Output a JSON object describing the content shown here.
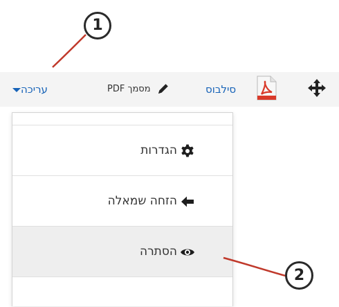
{
  "toolbar": {
    "edit_menu_label": "עריכה",
    "document_label": "מסמך PDF",
    "syllabus_link": "סילבוס"
  },
  "dropdown": {
    "items": [
      {
        "label": "הגדרות",
        "icon": "gear-icon"
      },
      {
        "label": "הזחה שמאלה",
        "icon": "arrow-left-icon"
      },
      {
        "label": "הסתרה",
        "icon": "eye-icon"
      }
    ]
  },
  "callouts": {
    "first": "1",
    "second": "2"
  },
  "colors": {
    "link_blue": "#1763b8",
    "pdf_red": "#d93a2a",
    "annotation_red": "#c0392b",
    "toolbar_bg": "#f4f4f4",
    "highlight_bg": "#eeeeee"
  }
}
